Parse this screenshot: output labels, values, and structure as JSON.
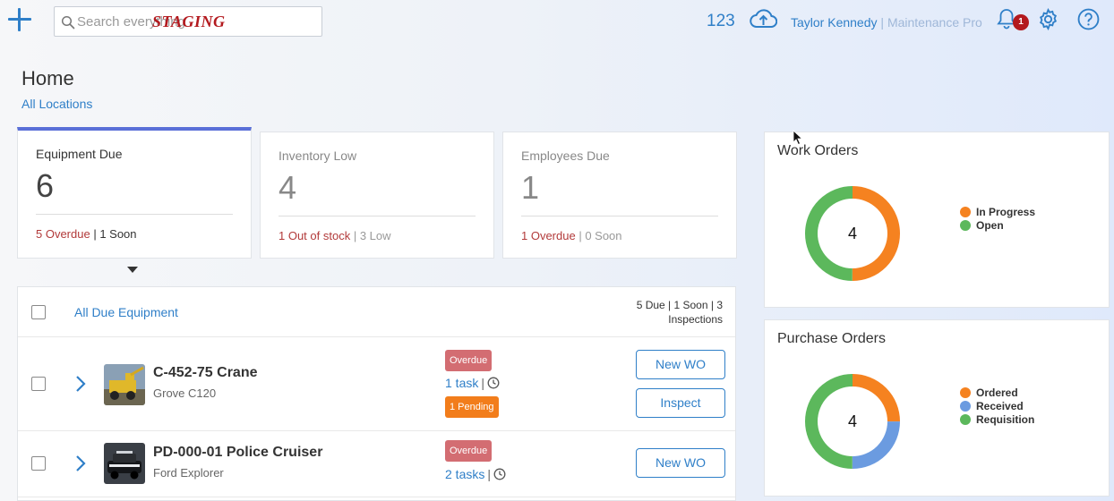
{
  "topbar": {
    "search_placeholder": "Search everything",
    "staging_label": "STAGING",
    "count": "123",
    "user_name": "Taylor Kennedy",
    "user_sep": " | ",
    "user_role": "Maintenance Pro",
    "notification_count": "1",
    "icons": [
      "plus-icon",
      "search-icon",
      "cloud-upload-icon",
      "bell-icon",
      "gear-icon",
      "help-icon"
    ]
  },
  "page": {
    "title": "Home",
    "location_link": "All Locations"
  },
  "kpis": [
    {
      "title": "Equipment Due",
      "value": "6",
      "foot_a": "5 Overdue",
      "foot_sep": " | ",
      "foot_b": "1 Soon",
      "active": true
    },
    {
      "title": "Inventory Low",
      "value": "4",
      "foot_a": "1 Out of stock",
      "foot_sep": " | ",
      "foot_b": "3 Low",
      "active": false
    },
    {
      "title": "Employees Due",
      "value": "1",
      "foot_a": "1 Overdue",
      "foot_sep": " | ",
      "foot_b": "0 Soon",
      "active": false
    }
  ],
  "equipment": {
    "header_link": "All Due Equipment",
    "summary_line1": "5 Due | 1 Soon | 3",
    "summary_line2": "Inspections",
    "rows": [
      {
        "name": "C-452-75 Crane",
        "model": "Grove C120",
        "status": "Overdue",
        "tasks": "1 task",
        "task_sep": "|",
        "pending": "1 Pending",
        "actions": [
          "New WO",
          "Inspect"
        ]
      },
      {
        "name": "PD-000-01 Police Cruiser",
        "model": "Ford Explorer",
        "status": "Overdue",
        "tasks": "2 tasks",
        "task_sep": "|",
        "actions": [
          "New WO"
        ]
      }
    ]
  },
  "colors": {
    "accent": "#2f7fc8",
    "overdue": "#d36d72",
    "pending": "#f27d1b",
    "in_progress": "#f58220",
    "open": "#5cb85c",
    "received": "#6b9be0",
    "requisition": "#5cb85c",
    "ordered": "#f58220",
    "staging": "#b3191e"
  },
  "chart_data": [
    {
      "type": "pie",
      "title": "Work Orders",
      "center_label": "4",
      "categories": [
        "In Progress",
        "Open"
      ],
      "values": [
        2,
        2
      ],
      "colors": [
        "#f58220",
        "#5cb85c"
      ],
      "legend": "right"
    },
    {
      "type": "pie",
      "title": "Purchase Orders",
      "center_label": "4",
      "categories": [
        "Ordered",
        "Received",
        "Requisition"
      ],
      "values": [
        1,
        1,
        2
      ],
      "colors": [
        "#f58220",
        "#6b9be0",
        "#5cb85c"
      ],
      "legend": "right"
    }
  ]
}
